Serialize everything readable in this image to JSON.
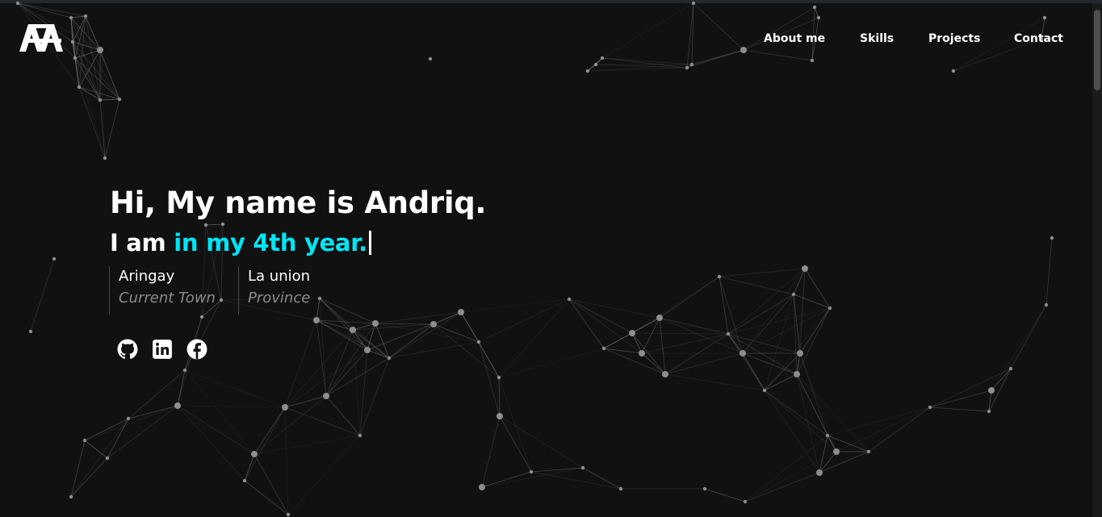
{
  "brand": {
    "logo_alt": "AA logo"
  },
  "nav": {
    "items": [
      {
        "label": "About me"
      },
      {
        "label": "Skills"
      },
      {
        "label": "Projects"
      },
      {
        "label": "Contact"
      }
    ]
  },
  "hero": {
    "greeting": "Hi, My name is Andriq.",
    "typed_prefix": "I am ",
    "typed_text": "in my 4th year.",
    "locations": [
      {
        "value": "Aringay",
        "label": "Current Town"
      },
      {
        "value": "La union",
        "label": "Province"
      }
    ]
  },
  "socials": [
    {
      "icon": "github-icon"
    },
    {
      "icon": "linkedin-icon"
    },
    {
      "icon": "facebook-icon"
    }
  ],
  "colors": {
    "background": "#111111",
    "accent": "#00e5f5",
    "text": "#ffffff",
    "muted": "#8a8a8a",
    "particle": "#9a9a9a"
  }
}
